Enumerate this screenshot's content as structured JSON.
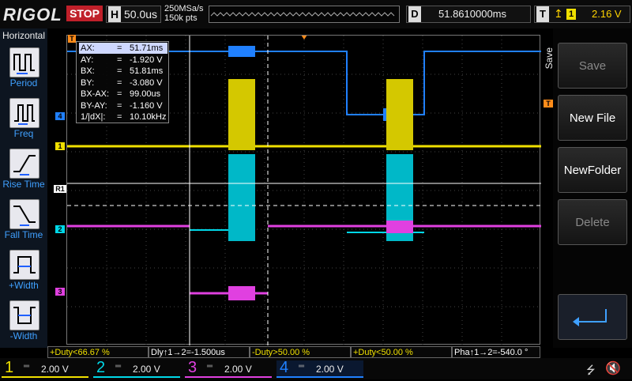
{
  "topbar": {
    "logo": "RIGOL",
    "run_state": "STOP",
    "timebase_label": "H",
    "timebase": "50.0us",
    "sample_rate": "250MSa/s",
    "memory_depth": "150k pts",
    "delay_label": "D",
    "delay": "51.8610000ms",
    "trigger_label": "T",
    "trigger_edge_icon": "rising-edge-icon",
    "trigger_source": "1",
    "trigger_level": "2.16 V"
  },
  "sidebar": {
    "title": "Horizontal",
    "items": [
      {
        "label": "Period",
        "icon": "period-icon"
      },
      {
        "label": "Freq",
        "icon": "freq-icon"
      },
      {
        "label": "Rise Time",
        "icon": "rise-time-icon"
      },
      {
        "label": "Fall Time",
        "icon": "fall-time-icon"
      },
      {
        "label": "+Width",
        "icon": "plus-width-icon"
      },
      {
        "label": "-Width",
        "icon": "minus-width-icon"
      }
    ]
  },
  "cursor_readout": {
    "rows": [
      {
        "key": "AX:",
        "eq": "=",
        "value": "51.71ms"
      },
      {
        "key": "AY:",
        "eq": "=",
        "value": "-1.920 V"
      },
      {
        "key": "BX:",
        "eq": "=",
        "value": "51.81ms"
      },
      {
        "key": "BY:",
        "eq": "=",
        "value": "-3.080 V"
      },
      {
        "key": "BX-AX:",
        "eq": "=",
        "value": "99.00us"
      },
      {
        "key": "BY-AY:",
        "eq": "=",
        "value": "-1.160 V"
      },
      {
        "key": "1/|dX|:",
        "eq": "=",
        "value": "10.10kHz"
      }
    ]
  },
  "markers": {
    "ch1": "1",
    "ch2": "2",
    "ch3": "3",
    "ch4": "4",
    "ref": "R1",
    "trig": "T"
  },
  "right_menu": {
    "tab": "Save",
    "buttons": [
      {
        "label": "Save",
        "enabled": false
      },
      {
        "label": "New File",
        "enabled": true
      },
      {
        "label": "NewFolder",
        "enabled": true
      },
      {
        "label": "Delete",
        "enabled": false
      },
      {
        "label": "",
        "icon": "return-icon",
        "enabled": true
      }
    ]
  },
  "measurements": [
    "+Duty<66.67 %",
    "Dly↑1→2=-1.500us",
    "-Duty>50.00 %",
    "+Duty<50.00 %",
    "Pha↑1→2=-540.0 °"
  ],
  "channels": [
    {
      "num": "1",
      "scale": "2.00 V",
      "color": "#f0e000"
    },
    {
      "num": "2",
      "scale": "2.00 V",
      "color": "#00d8e8"
    },
    {
      "num": "3",
      "scale": "2.00 V",
      "color": "#e040e0"
    },
    {
      "num": "4",
      "scale": "2.00 V",
      "color": "#2080ff"
    }
  ],
  "colors": {
    "ch1": "#f0e000",
    "ch2": "#00d8e8",
    "ch3": "#e040e0",
    "ch4": "#2080ff",
    "stop": "#c0202a",
    "trigger_marker": "#ff8c1a"
  }
}
